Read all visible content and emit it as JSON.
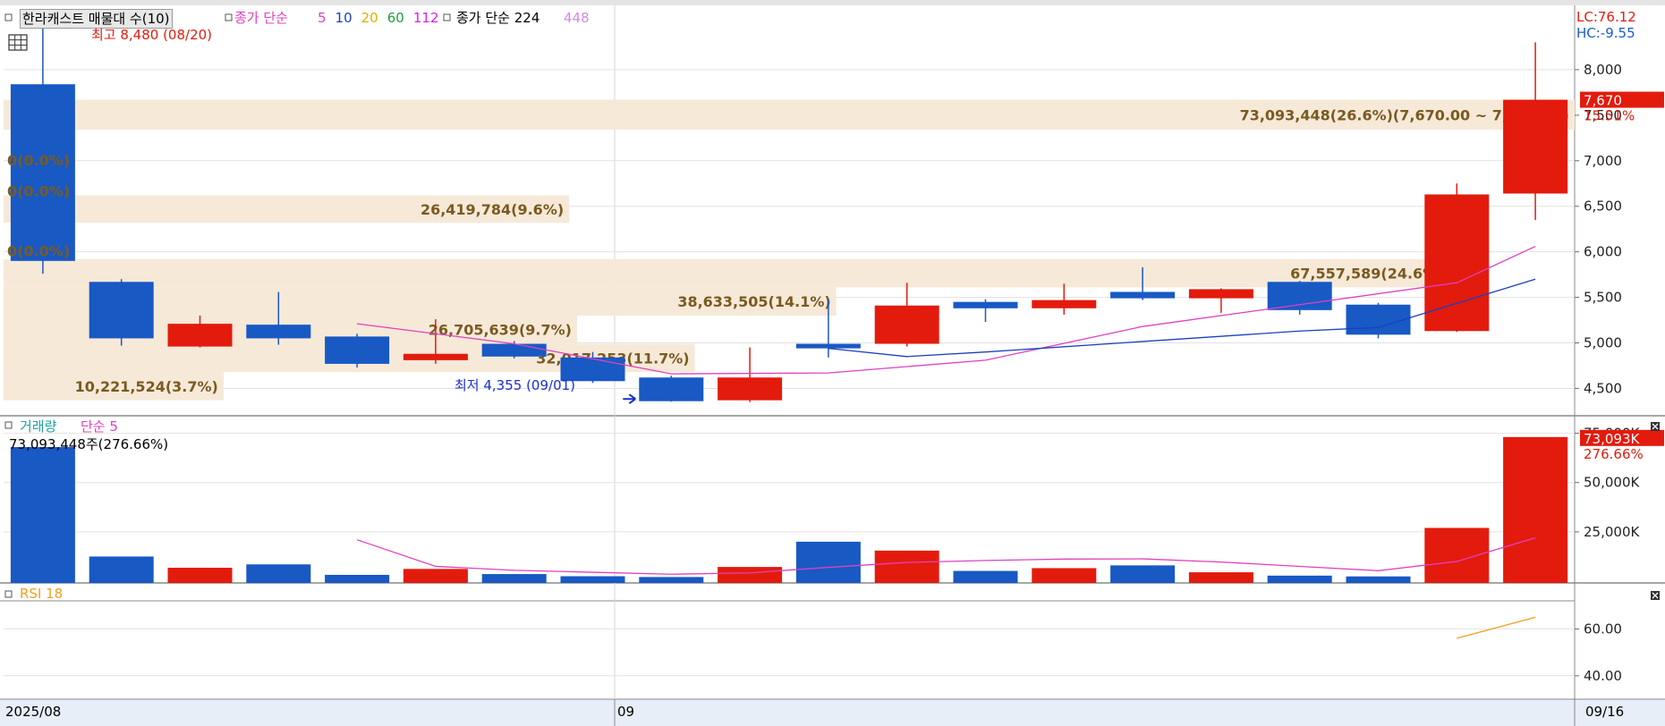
{
  "title_bar": {
    "indicator_name": "한라캐스트 매물대 수(10)",
    "ma_label": "종가 단순",
    "ma_periods": [
      "5",
      "10",
      "20",
      "60",
      "112"
    ],
    "ma_colors": [
      "#e040c0",
      "#1a3fc0",
      "#e0b000",
      "#20a040",
      "#e020e0"
    ],
    "ma2_label": "종가 단순 224",
    "ma2_extra": "448"
  },
  "right_info": {
    "lc": "LC:76.12",
    "hc": "HC:-9.55",
    "last_price": "7,670",
    "last_pct": "15.51%"
  },
  "annotations": {
    "high": "최고 8,480 (08/20)",
    "low": "최저 4,355 (09/01)",
    "volume_last": "73,093,448주(276.66%)",
    "volume_last_tag": "73,093K",
    "volume_pct_tag": "276.66%"
  },
  "volume_panel": {
    "label": "거래량",
    "ma_label": "단순 5"
  },
  "rsi_panel": {
    "label": "RSI 18"
  },
  "x_axis": {
    "start": "2025/08",
    "month": "09",
    "end": "09/16"
  },
  "chart_data": {
    "type": "candlestick",
    "price_axis": {
      "ticks": [
        "8,000",
        "7,500",
        "7,000",
        "6,500",
        "6,000",
        "5,500",
        "5,000",
        "4,500"
      ],
      "range": [
        4200,
        8500
      ]
    },
    "volume_axis": {
      "ticks": [
        "25,000K",
        "50,000K",
        "75,000K"
      ],
      "range": [
        0,
        78000
      ]
    },
    "rsi_axis": {
      "ticks": [
        "60.00",
        "40.00"
      ],
      "range": [
        30,
        72
      ]
    },
    "candles": [
      {
        "o": 7840,
        "h": 8480,
        "l": 5760,
        "c": 5900,
        "vol": 68000
      },
      {
        "o": 5670,
        "h": 5700,
        "l": 4970,
        "c": 5050,
        "vol": 12500
      },
      {
        "o": 4960,
        "h": 5300,
        "l": 4950,
        "c": 5210,
        "vol": 6800
      },
      {
        "o": 5200,
        "h": 5560,
        "l": 4980,
        "c": 5050,
        "vol": 8500
      },
      {
        "o": 5070,
        "h": 5100,
        "l": 4730,
        "c": 4770,
        "vol": 3200
      },
      {
        "o": 4810,
        "h": 5260,
        "l": 4770,
        "c": 4880,
        "vol": 6200
      },
      {
        "o": 4990,
        "h": 5020,
        "l": 4830,
        "c": 4850,
        "vol": 3600
      },
      {
        "o": 4840,
        "h": 4900,
        "l": 4560,
        "c": 4580,
        "vol": 2500
      },
      {
        "o": 4620,
        "h": 4640,
        "l": 4355,
        "c": 4360,
        "vol": 2100
      },
      {
        "o": 4370,
        "h": 4950,
        "l": 4350,
        "c": 4620,
        "vol": 7200
      },
      {
        "o": 4990,
        "h": 5480,
        "l": 4840,
        "c": 4940,
        "vol": 20000
      },
      {
        "o": 4990,
        "h": 5660,
        "l": 4960,
        "c": 5410,
        "vol": 15500
      },
      {
        "o": 5450,
        "h": 5480,
        "l": 5230,
        "c": 5380,
        "vol": 5200
      },
      {
        "o": 5380,
        "h": 5650,
        "l": 5310,
        "c": 5470,
        "vol": 6600
      },
      {
        "o": 5560,
        "h": 5830,
        "l": 5470,
        "c": 5490,
        "vol": 8000
      },
      {
        "o": 5490,
        "h": 5600,
        "l": 5330,
        "c": 5590,
        "vol": 4500
      },
      {
        "o": 5670,
        "h": 5680,
        "l": 5310,
        "c": 5360,
        "vol": 2800
      },
      {
        "o": 5420,
        "h": 5440,
        "l": 5050,
        "c": 5090,
        "vol": 2400
      },
      {
        "o": 5130,
        "h": 6750,
        "l": 5120,
        "c": 6630,
        "vol": 27000
      },
      {
        "o": 6640,
        "h": 8300,
        "l": 6350,
        "c": 7670,
        "vol": 73093
      }
    ],
    "ma5": [
      null,
      null,
      null,
      null,
      5210,
      null,
      4990,
      null,
      4660,
      null,
      4670,
      null,
      4810,
      null,
      5180,
      null,
      5420,
      null,
      5660,
      6060
    ],
    "ma10": [
      null,
      null,
      null,
      null,
      null,
      null,
      null,
      null,
      null,
      null,
      4940,
      4850,
      4900,
      null,
      null,
      null,
      5130,
      5170,
      null,
      5700
    ],
    "volume_ma5": [
      null,
      null,
      null,
      null,
      21000,
      7500,
      5500,
      4500,
      3500,
      4200,
      7000,
      9500,
      10500,
      11200,
      11300,
      9700,
      7500,
      5300,
      10000,
      22000
    ],
    "rsi": [
      null,
      null,
      null,
      null,
      null,
      null,
      null,
      null,
      null,
      null,
      null,
      null,
      null,
      null,
      null,
      null,
      null,
      null,
      56,
      65
    ],
    "volume_profile": [
      {
        "lo": 7340,
        "hi": 7670,
        "label": "73,093,448(26.6%)(7,670.00 ~ 7,340.00)",
        "frac": 1.0
      },
      {
        "lo": 6320,
        "hi": 6620,
        "label": "26,419,784(9.6%)",
        "frac": 0.36
      },
      {
        "lo": 5610,
        "hi": 5920,
        "label": "67,557,589(24.6%)",
        "frac": 0.92
      },
      {
        "lo": 5300,
        "hi": 5610,
        "label": "38,633,505(14.1%)",
        "frac": 0.53
      },
      {
        "lo": 4990,
        "hi": 5300,
        "label": "26,705,639(9.7%)",
        "frac": 0.365
      },
      {
        "lo": 4680,
        "hi": 4990,
        "label": "32,017,253(11.7%)",
        "frac": 0.44
      },
      {
        "lo": 4370,
        "hi": 4680,
        "label": "10,221,524(3.7%)",
        "frac": 0.14
      }
    ],
    "zero_bands": [
      "0(0.0%)",
      "0(0.0%)",
      "0(0.0%)"
    ],
    "zero_band_prices": [
      7010,
      6670,
      6010
    ],
    "colors": {
      "up": "#e31b0d",
      "down": "#1859c4",
      "ma5": "#e040c0",
      "ma10": "#1a3fc0",
      "profile": "#f6e9d8",
      "profile_text": "#7a5a20",
      "rsi": "#f0a020"
    }
  }
}
